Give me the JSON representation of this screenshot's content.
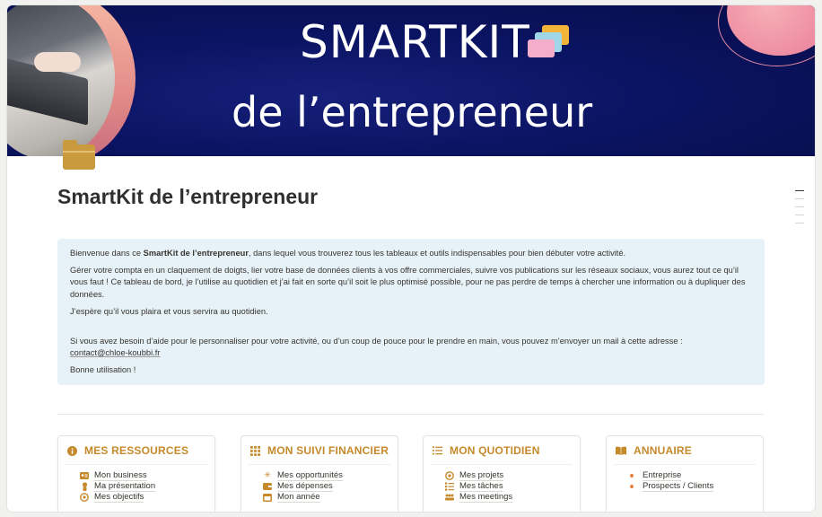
{
  "banner": {
    "line1": "SMARTKIT",
    "line2": "de l’entrepreneur"
  },
  "page": {
    "title": "SmartKit de l’entrepreneur",
    "icon": "folder-icon"
  },
  "callout": {
    "p1_before": "Bienvenue dans ce ",
    "p1_bold": "SmartKit de l’entrepreneur",
    "p1_after": ", dans lequel vous trouverez tous les tableaux et outils indispensables pour bien débuter votre activité.",
    "p2": "Gérer votre compta en un claquement de doigts, lier votre base de données clients à vos offre commerciales, suivre vos publications sur les réseaux sociaux, vous aurez tout ce qu’il vous faut ! Ce tableau de bord, je l’utilise au quotidien et j’ai fait en sorte qu’il soit le plus optimisé possible, pour ne pas perdre de temps à chercher une information ou à dupliquer des données.",
    "p3": "J’espère qu’il vous plaira et vous servira au quotidien.",
    "p4": "Si vous avez besoin d’aide pour le personnaliser pour votre activité, ou d’un coup de pouce pour le prendre en main, vous pouvez m’envoyer un mail à cette adresse :",
    "email": "contact@chloe-koubbi.fr",
    "p5": "Bonne utilisation !"
  },
  "cards": [
    {
      "title": "MES RESSOURCES",
      "icon": "info-icon",
      "items": [
        {
          "label": "Mon business",
          "icon": "id-card-icon"
        },
        {
          "label": "Ma présentation",
          "icon": "person-icon"
        },
        {
          "label": "Mes objectifs",
          "icon": "target-icon"
        }
      ]
    },
    {
      "title": "MON SUIVI FINANCIER",
      "icon": "grid-icon",
      "items": [
        {
          "label": "Mes opportunités",
          "icon": "sparkle-icon"
        },
        {
          "label": "Mes dépenses",
          "icon": "wallet-icon"
        },
        {
          "label": "Mon année",
          "icon": "calendar-icon"
        }
      ]
    },
    {
      "title": "MON QUOTIDIEN",
      "icon": "list-icon",
      "items": [
        {
          "label": "Mes projets",
          "icon": "target-icon"
        },
        {
          "label": "Mes tâches",
          "icon": "checklist-icon"
        },
        {
          "label": "Mes meetings",
          "icon": "people-icon"
        }
      ]
    },
    {
      "title": "ANNUAIRE",
      "icon": "book-icon",
      "items": [
        {
          "label": "Entreprise",
          "icon": "bullet-icon"
        },
        {
          "label": "Prospects / Clients",
          "icon": "bullet-icon"
        }
      ]
    }
  ],
  "colors": {
    "accent": "#c48a2c",
    "banner_bg": "#0b1463",
    "callout_bg": "#e7f1f8"
  }
}
